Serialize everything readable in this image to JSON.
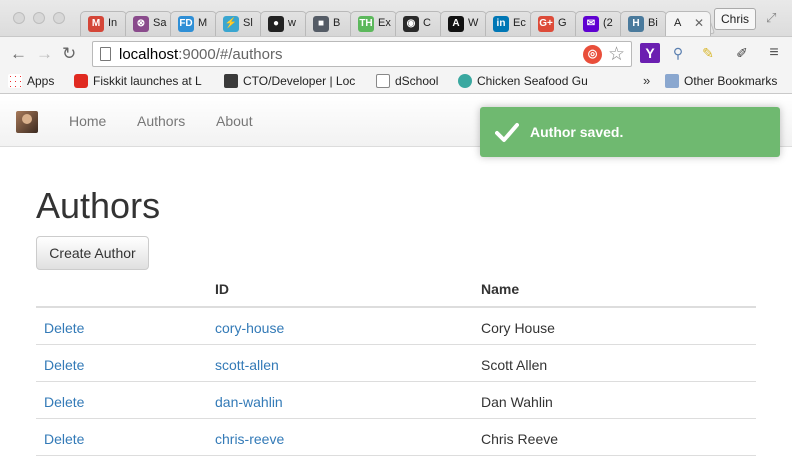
{
  "browser": {
    "tabs": [
      {
        "title": "In",
        "icon": "gmail-icon",
        "color": "#d44638",
        "glyph": "M"
      },
      {
        "title": "Sa",
        "icon": "sa-icon",
        "color": "#8a4b8c",
        "glyph": "⊗"
      },
      {
        "title": "M",
        "icon": "fd-icon",
        "color": "#2f8fd6",
        "glyph": "FD"
      },
      {
        "title": "Sl",
        "icon": "sl-icon",
        "color": "#3aa6d0",
        "glyph": "⚡"
      },
      {
        "title": "w",
        "icon": "github-icon",
        "color": "#222222",
        "glyph": "●"
      },
      {
        "title": "B",
        "icon": "b-icon",
        "color": "#555c66",
        "glyph": "■"
      },
      {
        "title": "Ex",
        "icon": "th-icon",
        "color": "#5cb85c",
        "glyph": "TH"
      },
      {
        "title": "C",
        "icon": "c-icon",
        "color": "#2a2a2a",
        "glyph": "◉"
      },
      {
        "title": "W",
        "icon": "w-icon",
        "color": "#111111",
        "glyph": "A"
      },
      {
        "title": "Ec",
        "icon": "linkedin-icon",
        "color": "#0077b5",
        "glyph": "in"
      },
      {
        "title": "G",
        "icon": "google-plus-icon",
        "color": "#dd4b39",
        "glyph": "G+"
      },
      {
        "title": "(2",
        "icon": "yahoo-mail-icon",
        "color": "#5f01d1",
        "glyph": "✉"
      },
      {
        "title": "Bi",
        "icon": "h-icon",
        "color": "#4a7a9c",
        "glyph": "H"
      },
      {
        "title": "A",
        "icon": "active-tab-icon",
        "color": "#f4f4f4",
        "glyph": ""
      }
    ],
    "profile_name": "Chris",
    "url_host": "localhost",
    "url_rest": ":9000/#/authors",
    "bookmarks": [
      {
        "label": "Apps",
        "icon": "apps-grid-icon"
      },
      {
        "label": "Fiskkit launches at L",
        "icon": "youtube-icon"
      },
      {
        "label": "CTO/Developer | Loc",
        "icon": "ls-icon"
      },
      {
        "label": "dSchool",
        "icon": "page-icon"
      },
      {
        "label": "Chicken Seafood Gu",
        "icon": "gear-icon"
      }
    ],
    "overflow": "»",
    "other_bookmarks": "Other Bookmarks"
  },
  "nav": {
    "links": [
      "Home",
      "Authors",
      "About"
    ]
  },
  "toast": {
    "message": "Author saved.",
    "color": "#6fb970"
  },
  "page": {
    "title": "Authors",
    "create_button": "Create Author",
    "columns": [
      "",
      "ID",
      "Name"
    ],
    "rows": [
      {
        "action": "Delete",
        "id": "cory-house",
        "name": "Cory House"
      },
      {
        "action": "Delete",
        "id": "scott-allen",
        "name": "Scott Allen"
      },
      {
        "action": "Delete",
        "id": "dan-wahlin",
        "name": "Dan Wahlin"
      },
      {
        "action": "Delete",
        "id": "chris-reeve",
        "name": "Chris Reeve"
      }
    ]
  },
  "colors": {
    "link": "#337ab7",
    "toast": "#6fb970"
  }
}
